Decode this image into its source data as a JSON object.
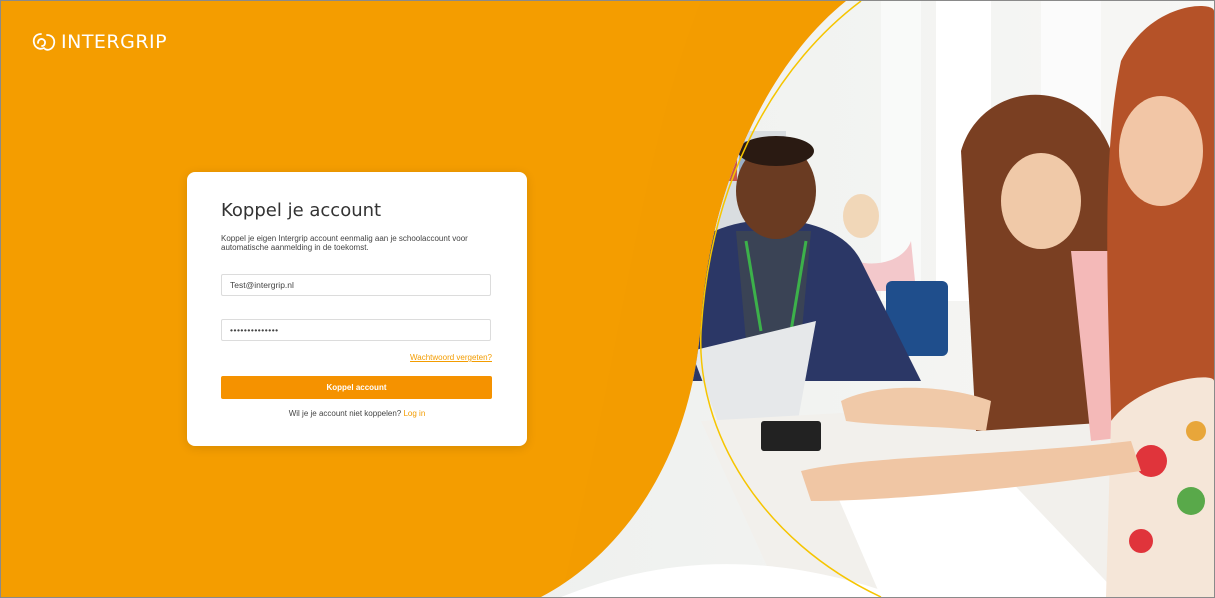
{
  "brand": {
    "name": "INTERGRIP",
    "primary_color": "#f39c00"
  },
  "card": {
    "title": "Koppel je account",
    "intro": "Koppel je eigen Intergrip account eenmalig aan je schoolaccount voor automatische aanmelding in de toekomst.",
    "email_value": "Test@intergrip.nl",
    "password_value": "••••••••••••••",
    "forgot_link": "Wachtwoord vergeten?",
    "submit_label": "Koppel account",
    "alt_text": "Wil je je account niet koppelen?",
    "alt_link": "Log in"
  },
  "hero": {
    "icon": "students-classroom-photo"
  }
}
